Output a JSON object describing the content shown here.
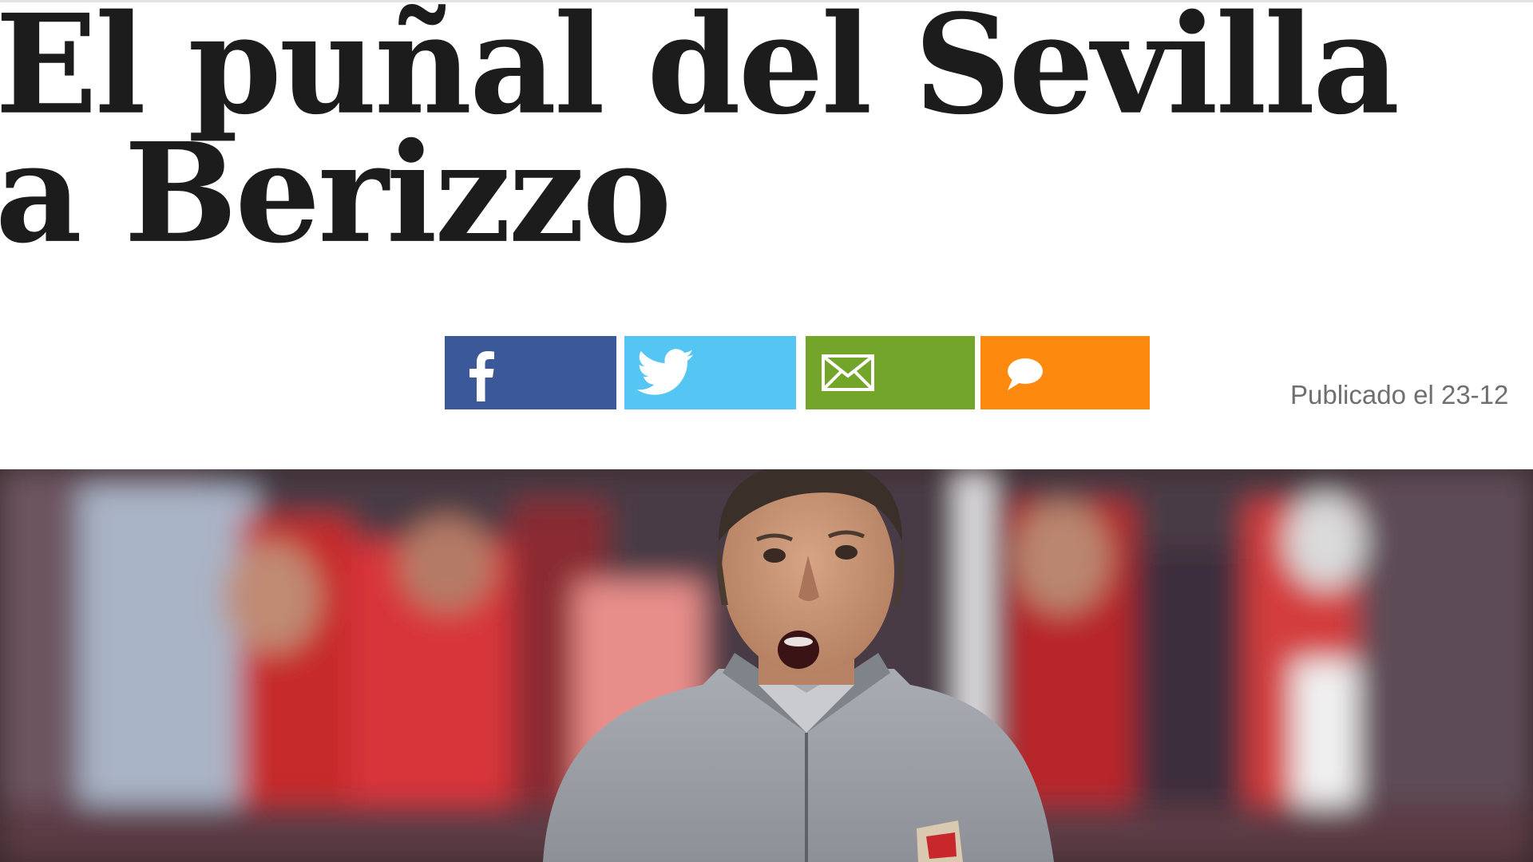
{
  "article": {
    "headline": "El puñal del Sevilla a Berizzo",
    "published": "Publicado el 23-12"
  },
  "share": {
    "buttons": [
      {
        "network": "facebook",
        "icon": "facebook-icon",
        "color": "#3b5998"
      },
      {
        "network": "twitter",
        "icon": "twitter-icon",
        "color": "#55c6f4"
      },
      {
        "network": "email",
        "icon": "mail-icon",
        "color": "#72a52a"
      },
      {
        "network": "comments",
        "icon": "comment-icon",
        "color": "#fd8a0f"
      }
    ]
  },
  "colors": {
    "headline": "#1c1c1c",
    "published_text": "#6f6f6f"
  }
}
